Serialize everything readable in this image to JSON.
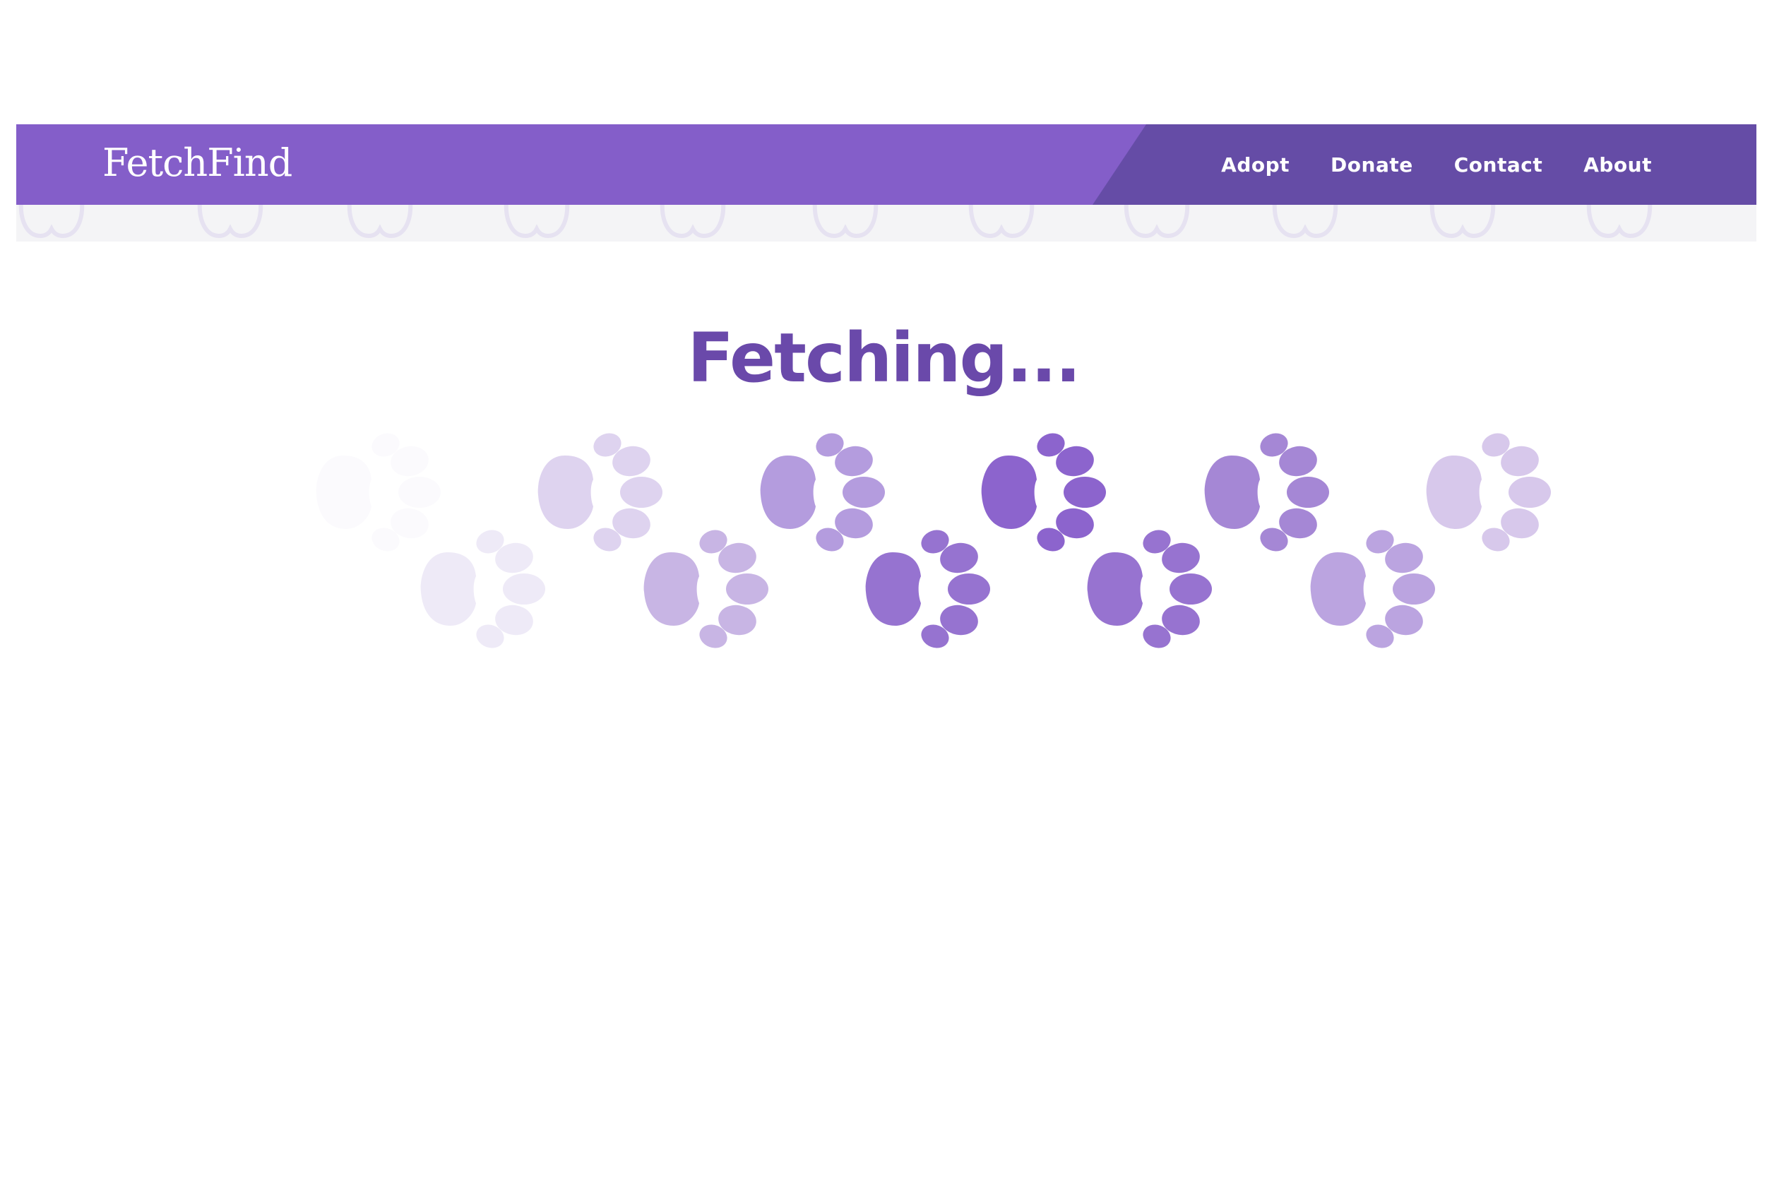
{
  "header": {
    "logo": "FetchFind",
    "nav": [
      {
        "label": "Adopt"
      },
      {
        "label": "Donate"
      },
      {
        "label": "Contact"
      },
      {
        "label": "About"
      }
    ],
    "colors": {
      "primary": "#845ec9",
      "primary_dark": "#654ca6",
      "strip": "#f4f4f6"
    }
  },
  "loader": {
    "title": "Fetching...",
    "title_color": "#6a49aa",
    "icon": "paw-icon",
    "paw_colors": [
      "#fbfafd",
      "#eeeaf7",
      "#ded3ef",
      "#c8b5e4",
      "#b49cde",
      "#9673d0",
      "#8c64cd",
      "#9773d0",
      "#a587d5",
      "#bba4e0",
      "#d7c8eb"
    ]
  }
}
